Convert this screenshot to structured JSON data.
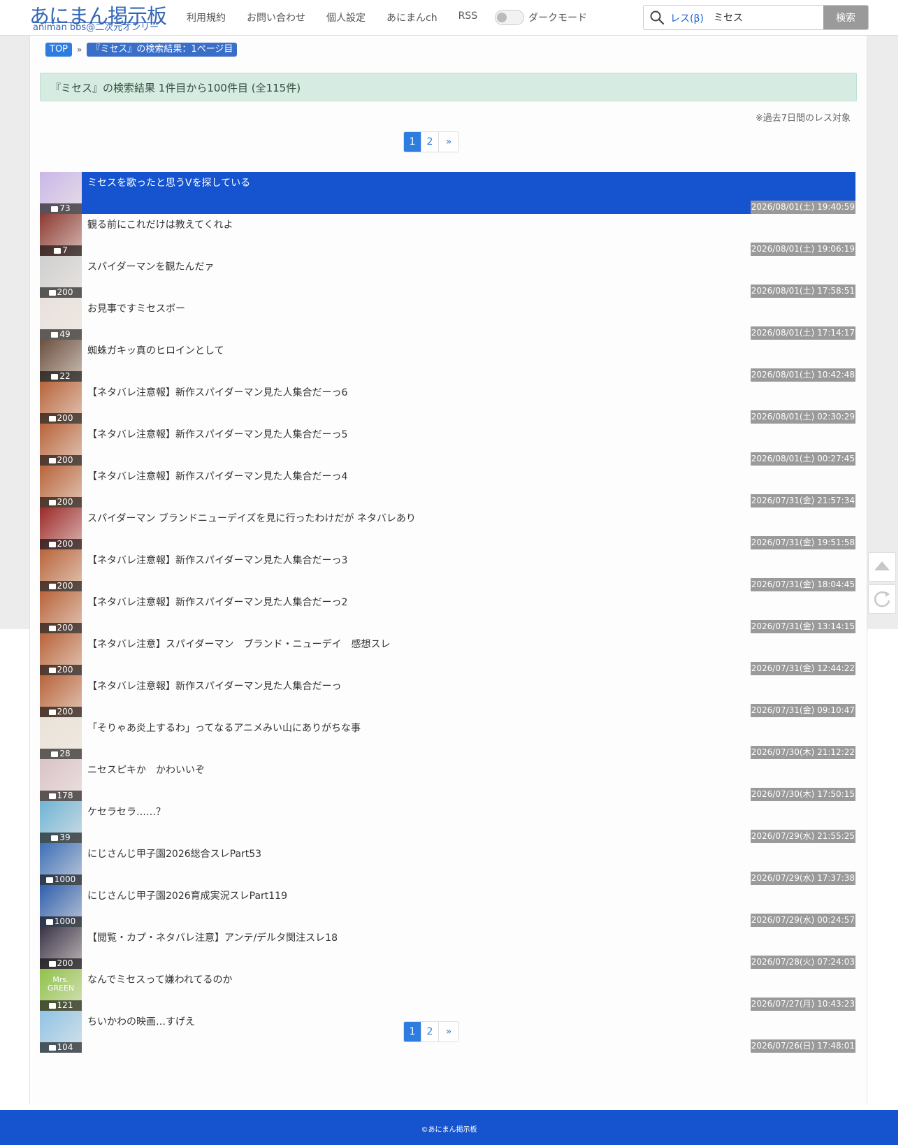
{
  "header": {
    "logo_title": "あにまん掲示板",
    "logo_subtitle": "animan bbs@二次元オンリー",
    "nav": [
      "利用規約",
      "お問い合わせ",
      "個人設定",
      "あにまんch",
      "RSS"
    ],
    "dark_mode_label": "ダークモード",
    "search_mode": "レス(β)",
    "search_value": "ミセス",
    "search_button": "検索"
  },
  "breadcrumb": {
    "top": "TOP",
    "sep": "»",
    "current": "『ミセス』の検索結果：1ページ目"
  },
  "result_summary": "『ミセス』の検索結果 1件目から100件目 (全115件)",
  "note": "※過去7日間のレス対象",
  "pager": {
    "pages": [
      "1",
      "2"
    ],
    "active": "1",
    "next": "»"
  },
  "threads": [
    {
      "title": "ミセスを歌ったと思うVを探している",
      "count": "73",
      "date": "2026/08/01(土) 19:40:59",
      "highlighted": true,
      "thumb": "#c9b7e8"
    },
    {
      "title": "観る前にこれだけは教えてくれよ",
      "count": "7",
      "date": "2026/08/01(土) 19:06:19",
      "thumb": "#8c3a32"
    },
    {
      "title": "スパイダーマンを観たんだァ",
      "count": "200",
      "date": "2026/08/01(土) 17:58:51",
      "thumb": "#cfcfcf"
    },
    {
      "title": "お見事ですミセスボー",
      "count": "49",
      "date": "2026/08/01(土) 17:14:17",
      "thumb": "#e8e0dc"
    },
    {
      "title": "蜘蛛ガキッ真のヒロインとして",
      "count": "22",
      "date": "2026/08/01(土) 10:42:48",
      "thumb": "#6b5040"
    },
    {
      "title": "【ネタバレ注意報】新作スパイダーマン見た人集合だーっ6",
      "count": "200",
      "date": "2026/08/01(土) 02:30:29",
      "thumb": "#b8643a"
    },
    {
      "title": "【ネタバレ注意報】新作スパイダーマン見た人集合だーっ5",
      "count": "200",
      "date": "2026/08/01(土) 00:27:45",
      "thumb": "#b8643a"
    },
    {
      "title": "【ネタバレ注意報】新作スパイダーマン見た人集合だーっ4",
      "count": "200",
      "date": "2026/07/31(金) 21:57:34",
      "thumb": "#b8643a"
    },
    {
      "title": "スパイダーマン ブランドニューデイズを見に行ったわけだが ネタバレあり",
      "count": "200",
      "date": "2026/07/31(金) 19:51:58",
      "thumb": "#9c2a2a"
    },
    {
      "title": "【ネタバレ注意報】新作スパイダーマン見た人集合だーっ3",
      "count": "200",
      "date": "2026/07/31(金) 18:04:45",
      "thumb": "#b8643a"
    },
    {
      "title": "【ネタバレ注意報】新作スパイダーマン見た人集合だーっ2",
      "count": "200",
      "date": "2026/07/31(金) 13:14:15",
      "thumb": "#b8643a"
    },
    {
      "title": "【ネタバレ注意】スパイダーマン　ブランド・ニューデイ　感想スレ",
      "count": "200",
      "date": "2026/07/31(金) 12:44:22",
      "thumb": "#b8643a"
    },
    {
      "title": "【ネタバレ注意報】新作スパイダーマン見た人集合だーっ",
      "count": "200",
      "date": "2026/07/31(金) 09:10:47",
      "thumb": "#b8643a"
    },
    {
      "title": "「そりゃあ炎上するわ」ってなるアニメみい山にありがちな事",
      "count": "28",
      "date": "2026/07/30(木) 21:12:22",
      "thumb": "#e9e2d8"
    },
    {
      "title": "ニセスピキか　かわいいぞ",
      "count": "178",
      "date": "2026/07/30(木) 17:50:15",
      "thumb": "#d9c3c8"
    },
    {
      "title": "ケセラセラ……？",
      "count": "39",
      "date": "2026/07/29(水) 21:55:25",
      "thumb": "#6fb4d6"
    },
    {
      "title": "にじさんじ甲子園2026総合スレPart53",
      "count": "1000",
      "date": "2026/07/29(水) 17:37:38",
      "thumb": "#3d6fb8"
    },
    {
      "title": "にじさんじ甲子園2026育成実況スレPart119",
      "count": "1000",
      "date": "2026/07/29(水) 00:24:57",
      "thumb": "#2f5fae"
    },
    {
      "title": "【閲覧・カプ・ネタバレ注意】アンテ/デルタ関注スレ18",
      "count": "200",
      "date": "2026/07/28(火) 07:24:03",
      "thumb": "#3a3346"
    },
    {
      "title": "なんでミセスって嫌われてるのか",
      "count": "121",
      "date": "2026/07/27(月) 10:43:23",
      "thumb": "#8fc24a",
      "thumb_text": "Mrs. GREEN"
    },
    {
      "title": "ちいかわの映画…すげえ",
      "count": "104",
      "date": "2026/07/26(日) 17:48:01",
      "thumb": "#8fc4e6"
    }
  ],
  "footer": "©あにまん掲示板"
}
